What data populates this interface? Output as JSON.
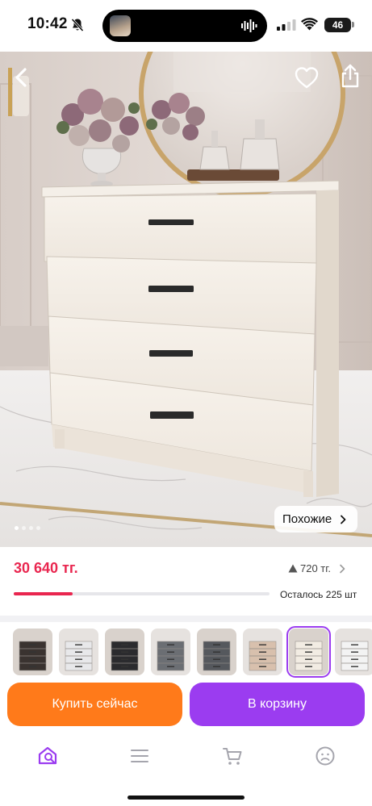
{
  "status": {
    "time": "10:42",
    "battery": "46"
  },
  "nav": {
    "back_icon": "chevron-left-icon",
    "favorite_icon": "heart-outline-icon",
    "share_icon": "share-icon"
  },
  "gallery": {
    "dots_total": 4,
    "dots_active": 1,
    "similar_label": "Похожие"
  },
  "price": {
    "current": "30 640 тг.",
    "drop": "720 тг.",
    "stock_label": "Осталось 225 шт",
    "stock_fraction": 0.23,
    "accent_color": "#e9264f"
  },
  "variants": [
    {
      "color": "#3a3330"
    },
    {
      "color": "#e8e8ea"
    },
    {
      "color": "#2b2b2e"
    },
    {
      "color": "#6b6e73"
    },
    {
      "color": "#55585d"
    },
    {
      "color": "#d8c0ad"
    },
    {
      "color": "#f2ece3"
    },
    {
      "color": "#f3f3f3"
    }
  ],
  "actions": {
    "buy_label": "Купить сейчас",
    "buy_color": "#ff7a1a",
    "cart_label": "В корзину",
    "cart_color": "#9b3cf0"
  },
  "tabbar": [
    {
      "icon": "home-search-icon",
      "active": true
    },
    {
      "icon": "menu-icon",
      "active": false
    },
    {
      "icon": "cart-icon",
      "active": false
    },
    {
      "icon": "profile-icon",
      "active": false
    }
  ]
}
